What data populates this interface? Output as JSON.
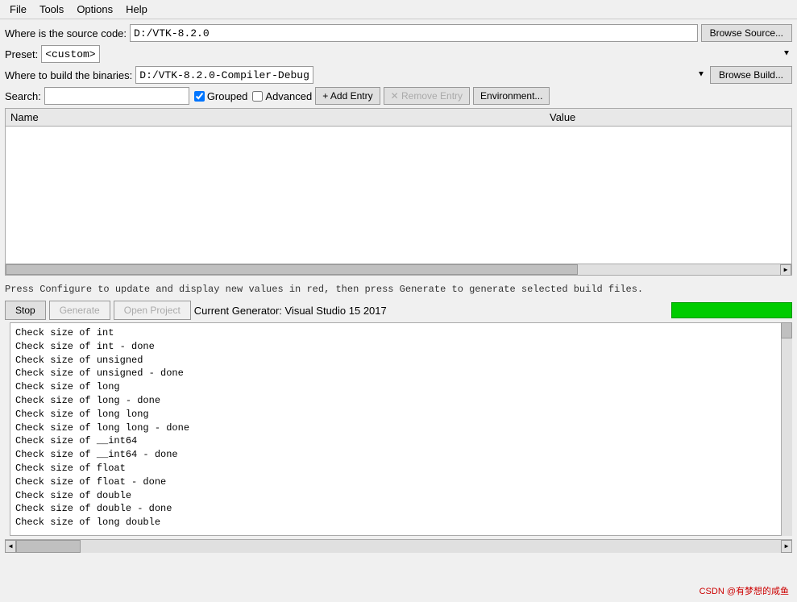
{
  "menu": {
    "items": [
      "File",
      "Tools",
      "Options",
      "Help"
    ]
  },
  "source_row": {
    "label": "Where is the source code:",
    "value": "D:/VTK-8.2.0",
    "btn": "Browse Source..."
  },
  "preset_row": {
    "label": "Preset:",
    "value": "<custom>"
  },
  "binary_row": {
    "label": "Where to build the binaries:",
    "value": "D:/VTK-8.2.0-Compiler-Debug",
    "btn": "Browse Build..."
  },
  "toolbar": {
    "search_label": "Search:",
    "search_placeholder": "",
    "grouped_label": "Grouped",
    "advanced_label": "Advanced",
    "add_entry_label": "+ Add Entry",
    "remove_entry_label": "✕ Remove Entry",
    "environment_label": "Environment..."
  },
  "table": {
    "col_name": "Name",
    "col_value": "Value",
    "rows": []
  },
  "info_text": "Press Configure to update and display new values in red, then press Generate to generate selected build files.",
  "actions": {
    "stop_label": "Stop",
    "generate_label": "Generate",
    "open_project_label": "Open Project",
    "generator_text": "Current Generator: Visual Studio 15 2017"
  },
  "log_lines": [
    "Check size of int",
    "Check size of int - done",
    "Check size of unsigned",
    "Check size of unsigned - done",
    "Check size of long",
    "Check size of long - done",
    "Check size of long long",
    "Check size of long long - done",
    "Check size of __int64",
    "Check size of __int64 - done",
    "Check size of float",
    "Check size of float - done",
    "Check size of double",
    "Check size of double - done",
    "Check size of long double"
  ],
  "watermark": "CSDN @有梦想的咸鱼"
}
